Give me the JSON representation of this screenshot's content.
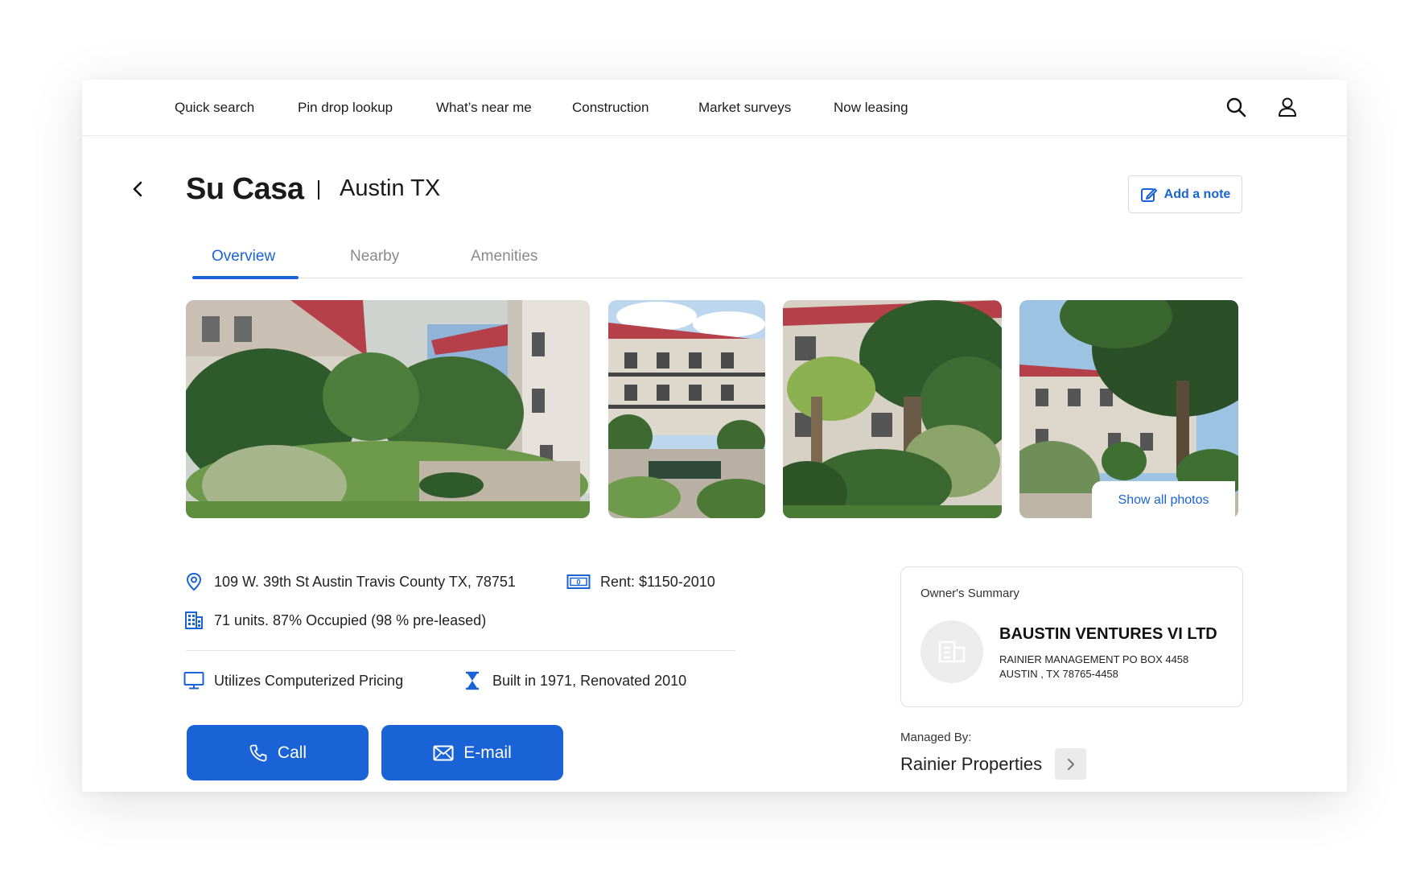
{
  "nav": {
    "items": [
      {
        "label": "Quick search"
      },
      {
        "label": "Pin drop lookup"
      },
      {
        "label": "What’s near me"
      },
      {
        "label": "Construction"
      },
      {
        "label": "Market surveys"
      },
      {
        "label": "Now leasing"
      }
    ],
    "icons": [
      "search-icon",
      "user-icon"
    ]
  },
  "header": {
    "title": "Su Casa",
    "subtitle": "Austin TX",
    "note_button": "Add a note"
  },
  "tabs": [
    {
      "label": "Overview",
      "active": true
    },
    {
      "label": "Nearby",
      "active": false
    },
    {
      "label": "Amenities",
      "active": false
    }
  ],
  "photos": {
    "show_all_label": "Show all photos"
  },
  "facts": {
    "address": "109 W. 39th St Austin Travis County TX, 78751",
    "rent": "Rent: $1150-2010",
    "units": "71 units. 87% Occupied (98 % pre-leased)",
    "pricing": "Utilizes Computerized Pricing",
    "built": "Built in 1971, Renovated 2010"
  },
  "actions": {
    "call_label": "Call",
    "email_label": "E-mail"
  },
  "owner": {
    "label": "Owner's Summary",
    "name": "BAUSTIN VENTURES VI LTD",
    "address_line1": "RAINIER MANAGEMENT PO BOX 4458",
    "address_line2": "AUSTIN , TX 78765-4458"
  },
  "managed": {
    "label": "Managed By:",
    "name": "Rainier Properties"
  },
  "colors": {
    "accent": "#1a63d6",
    "text": "#1a1a1a",
    "muted": "#8a8a8a",
    "roof": "#b5404a"
  }
}
